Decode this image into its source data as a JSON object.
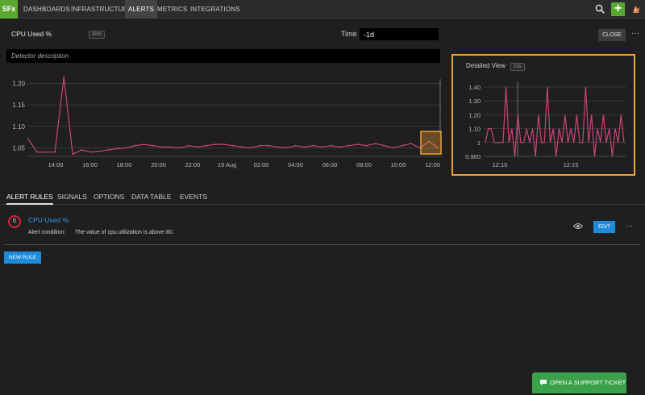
{
  "nav": {
    "logo": "SFx",
    "items": [
      {
        "label": "DASHBOARDS",
        "active": false
      },
      {
        "label": "INFRASTRUCTURE",
        "active": false
      },
      {
        "label": "ALERTS",
        "active": true
      },
      {
        "label": "METRICS",
        "active": false
      },
      {
        "label": "INTEGRATIONS",
        "active": false
      }
    ],
    "add_label": "+"
  },
  "detector": {
    "title": "CPU Used %",
    "resolution_badge": "30m",
    "time_label": "Time",
    "time_value": "-1d",
    "close_label": "CLOSE",
    "more_label": "···",
    "description_placeholder": "Detector description"
  },
  "detail": {
    "title": "Detailed View",
    "resolution_badge": "10s"
  },
  "chart_data": [
    {
      "type": "line",
      "series_color": "#c8457a",
      "ylim": [
        1.03,
        1.22
      ],
      "yticks": [
        "1.05",
        "1.10",
        "1.15",
        "1.20"
      ],
      "xticks": [
        "14:00",
        "16:00",
        "18:00",
        "20:00",
        "22:00",
        "19 Aug",
        "02:00",
        "04:00",
        "06:00",
        "08:00",
        "10:00",
        "12:00"
      ],
      "values": [
        1.07,
        1.04,
        1.04,
        1.04,
        1.215,
        1.035,
        1.045,
        1.04,
        1.042,
        1.045,
        1.048,
        1.05,
        1.055,
        1.058,
        1.055,
        1.052,
        1.052,
        1.05,
        1.055,
        1.052,
        1.055,
        1.058,
        1.058,
        1.055,
        1.052,
        1.05,
        1.055,
        1.055,
        1.052,
        1.05,
        1.055,
        1.052,
        1.055,
        1.052,
        1.055,
        1.052,
        1.055,
        1.058,
        1.055,
        1.06,
        1.055,
        1.05,
        1.055,
        1.06,
        1.05,
        1.065,
        1.05
      ]
    },
    {
      "type": "line",
      "series_color": "#c8457a",
      "ylim": [
        0.9,
        1.44
      ],
      "yticks": [
        "0.900",
        "1",
        "1.10",
        "1.20",
        "1.30",
        "1.40"
      ],
      "xticks": [
        "12:10",
        "12:15"
      ],
      "values": [
        1.0,
        1.1,
        1.1,
        1.0,
        1.0,
        1.0,
        1.0,
        1.4,
        1.0,
        1.1,
        0.9,
        1.2,
        1.0,
        1.0,
        1.1,
        1.0,
        1.1,
        0.9,
        1.2,
        1.0,
        1.0,
        1.4,
        1.0,
        1.1,
        0.9,
        1.1,
        1.0,
        1.2,
        1.0,
        1.1,
        1.0,
        1.2,
        1.0,
        1.0,
        1.4,
        1.0,
        1.2,
        0.9,
        1.1,
        1.0,
        1.2,
        1.0,
        1.1,
        0.9,
        1.1,
        1.0,
        1.2,
        1.0
      ]
    }
  ],
  "tabs": [
    {
      "label": "ALERT RULES",
      "active": true
    },
    {
      "label": "SIGNALS",
      "active": false
    },
    {
      "label": "OPTIONS",
      "active": false
    },
    {
      "label": "DATA TABLE",
      "active": false
    },
    {
      "label": "EVENTS",
      "active": false
    }
  ],
  "rule": {
    "count": "0",
    "name": "CPU Used %",
    "condition_label": "Alert condition:",
    "condition_text": "The value of cpu.utilization is above 80.",
    "edit_label": "EDIT",
    "more_label": "···"
  },
  "new_rule_label": "NEW RULE",
  "support_label": "OPEN A SUPPORT TICKET",
  "colors": {
    "accent_green": "#5aa832",
    "button_blue": "#1e8cdc",
    "highlight_orange": "#f0a13a",
    "alert_red": "#d0243f",
    "line_magenta": "#c8457a"
  }
}
